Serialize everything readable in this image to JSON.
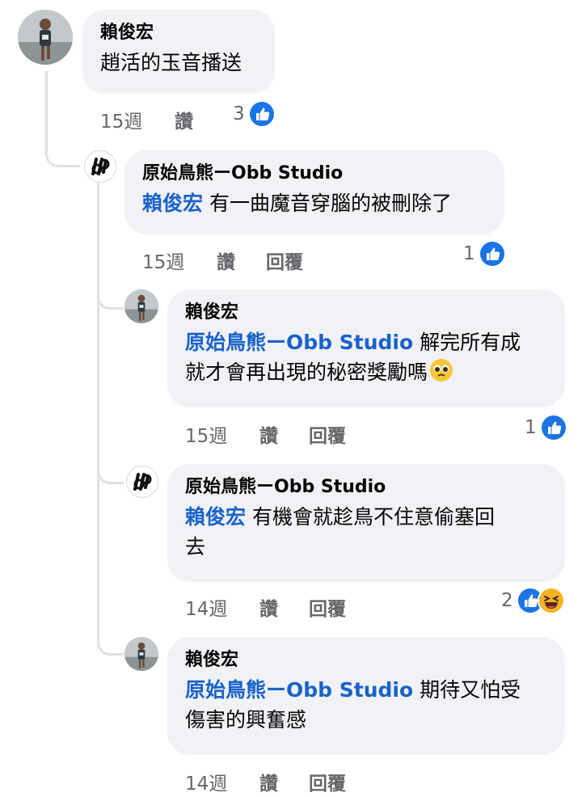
{
  "comments": [
    {
      "author": "賴俊宏",
      "text": "趙活的玉音播送",
      "time": "15週",
      "like_label": "讚",
      "reaction_count": "3",
      "reactions": [
        "like-icon"
      ]
    },
    {
      "author": "原始鳥熊ーObb Studio",
      "mention": "賴俊宏",
      "text": "有一曲魔音穿腦的被刪除了",
      "time": "15週",
      "like_label": "讚",
      "reply_label": "回覆",
      "reaction_count": "1",
      "reactions": [
        "like-icon"
      ]
    },
    {
      "author": "賴俊宏",
      "mention": "原始鳥熊ーObb Studio",
      "text_line1": "解完所有成",
      "text_line2": "就才會再出現的秘密獎勵嗎",
      "emoji": "pleading-face-emoji",
      "time": "15週",
      "like_label": "讚",
      "reply_label": "回覆",
      "reaction_count": "1",
      "reactions": [
        "like-icon"
      ]
    },
    {
      "author": "原始鳥熊ーObb Studio",
      "mention": "賴俊宏",
      "text_line1": "有機會就趁鳥不住意偷塞回",
      "text_line2": "去",
      "time": "14週",
      "like_label": "讚",
      "reply_label": "回覆",
      "reaction_count": "2",
      "reactions": [
        "like-icon",
        "haha-icon"
      ]
    },
    {
      "author": "賴俊宏",
      "mention": "原始鳥熊ーObb Studio",
      "text_line1": "期待又怕受",
      "text_line2": "傷害的興奮感",
      "time": "14週",
      "like_label": "讚",
      "reply_label": "回覆"
    }
  ],
  "colors": {
    "bubble": "#f0f2f5",
    "mention": "#1a62c9",
    "meta": "#65676b",
    "like_blue": "#1b74e4",
    "haha_yellow": "#f7b125",
    "thread_line": "#dfe1e5"
  }
}
